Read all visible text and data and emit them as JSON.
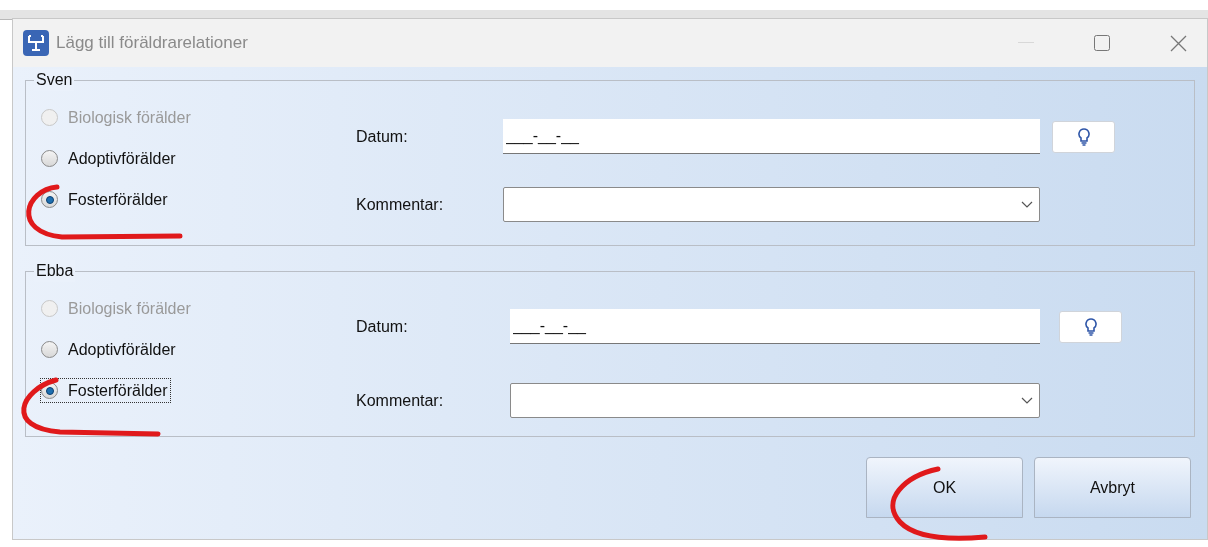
{
  "window": {
    "title": "Lägg till föräldrarelationer"
  },
  "groups": [
    {
      "title": "Sven",
      "options": [
        {
          "label": "Biologisk förälder",
          "selected": false,
          "disabled": true,
          "focused": false
        },
        {
          "label": "Adoptivförälder",
          "selected": false,
          "disabled": false,
          "focused": false
        },
        {
          "label": "Fosterförälder",
          "selected": true,
          "disabled": false,
          "focused": false
        }
      ],
      "date_label": "Datum:",
      "date_value": "___-__-__",
      "comment_label": "Kommentar:"
    },
    {
      "title": "Ebba",
      "options": [
        {
          "label": "Biologisk förälder",
          "selected": false,
          "disabled": true,
          "focused": false
        },
        {
          "label": "Adoptivförälder",
          "selected": false,
          "disabled": false,
          "focused": false
        },
        {
          "label": "Fosterförälder",
          "selected": true,
          "disabled": false,
          "focused": true
        }
      ],
      "date_label": "Datum:",
      "date_value": "___-__-__",
      "comment_label": "Kommentar:"
    }
  ],
  "buttons": [
    {
      "label": "OK"
    },
    {
      "label": "Avbryt"
    }
  ]
}
